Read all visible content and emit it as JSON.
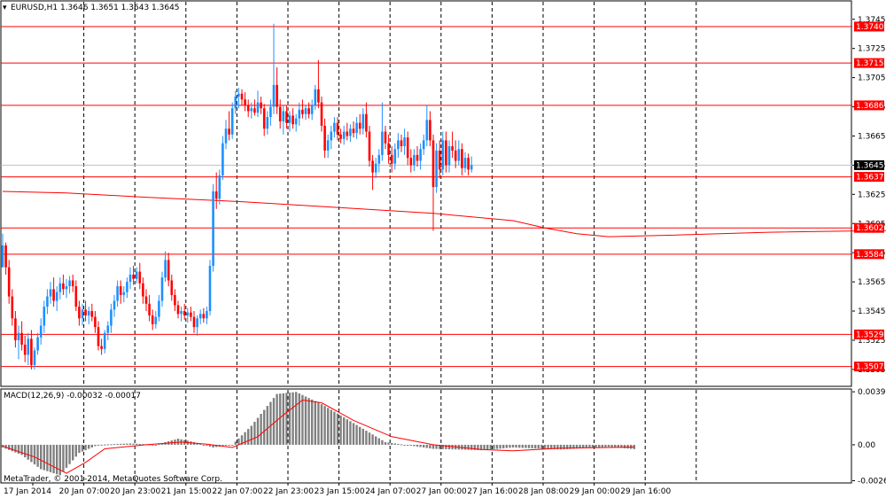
{
  "chart_data": {
    "type": "candlestick",
    "header": "EURUSD,H1  1.3646 1.3651 1.3643 1.3645",
    "colors": {
      "background": "#ffffff",
      "frame": "#000000",
      "bull_body": "#1e90ff",
      "bear_body": "#ff0000",
      "wick_up": "#1e90ff",
      "wick_down": "#ff0000",
      "level_line": "#ff0000",
      "ma_line": "#ff0000",
      "grid": "#000000",
      "macd_hist": "#808080",
      "macd_signal": "#ff0000",
      "price_line": "#c0c0c0",
      "current_box": "#000000"
    },
    "price_axis": {
      "ylim": [
        1.3494,
        1.3757
      ],
      "ticks": [
        "1.3745",
        "1.3725",
        "1.3705",
        "1.3685",
        "1.3665",
        "1.3645",
        "1.3625",
        "1.3605",
        "1.3585",
        "1.3565",
        "1.3545",
        "1.3525",
        "1.3505"
      ]
    },
    "levels": [
      "1.3740",
      "1.3715",
      "1.3686",
      "1.3637",
      "1.3602",
      "1.3584",
      "1.3529",
      "1.3507"
    ],
    "current_price": "1.3645",
    "ma_points": [
      [
        0,
        1.3627
      ],
      [
        20,
        1.3626
      ],
      [
        45,
        1.3623
      ],
      [
        75,
        1.362
      ],
      [
        105,
        1.3616
      ],
      [
        135,
        1.3612
      ],
      [
        160,
        1.3607
      ],
      [
        170,
        1.3602
      ],
      [
        180,
        1.3598
      ],
      [
        190,
        1.3596
      ],
      [
        210,
        1.3597
      ],
      [
        240,
        1.3599
      ],
      [
        270,
        1.36
      ],
      [
        300,
        1.3601
      ],
      [
        330,
        1.3607
      ],
      [
        360,
        1.3611
      ],
      [
        390,
        1.3614
      ],
      [
        415,
        1.362
      ]
    ],
    "x_ticks": [
      "17 Jan 2014",
      "20 Jan 07:00",
      "20 Jan 23:00",
      "21 Jan 15:00",
      "22 Jan 07:00",
      "22 Jan 23:00",
      "23 Jan 15:00",
      "24 Jan 07:00",
      "27 Jan 00:00",
      "27 Jan 16:00",
      "28 Jan 08:00",
      "29 Jan 00:00",
      "29 Jan 16:00"
    ],
    "candles_per_tick": 16,
    "ohlc": [
      [
        1.3575,
        1.3598,
        1.3575,
        1.359
      ],
      [
        1.359,
        1.3592,
        1.357,
        1.3575
      ],
      [
        1.3575,
        1.358,
        1.355,
        1.3555
      ],
      [
        1.3555,
        1.356,
        1.3535,
        1.354
      ],
      [
        1.354,
        1.3545,
        1.352,
        1.3525
      ],
      [
        1.3525,
        1.3535,
        1.3512,
        1.353
      ],
      [
        1.353,
        1.3538,
        1.3518,
        1.3522
      ],
      [
        1.3522,
        1.3528,
        1.351,
        1.3515
      ],
      [
        1.3515,
        1.353,
        1.3508,
        1.3526
      ],
      [
        1.3526,
        1.3532,
        1.3505,
        1.3508
      ],
      [
        1.3508,
        1.352,
        1.3505,
        1.3518
      ],
      [
        1.3518,
        1.353,
        1.3515,
        1.3527
      ],
      [
        1.3527,
        1.354,
        1.3522,
        1.3535
      ],
      [
        1.3535,
        1.3552,
        1.353,
        1.3548
      ],
      [
        1.3548,
        1.356,
        1.3543,
        1.3555
      ],
      [
        1.3555,
        1.3565,
        1.355,
        1.356
      ],
      [
        1.356,
        1.3568,
        1.3548,
        1.3552
      ],
      [
        1.3552,
        1.3562,
        1.3545,
        1.3558
      ],
      [
        1.3558,
        1.3568,
        1.3553,
        1.3564
      ],
      [
        1.3564,
        1.357,
        1.3556,
        1.356
      ],
      [
        1.356,
        1.3567,
        1.3554,
        1.3562
      ],
      [
        1.3562,
        1.3569,
        1.3557,
        1.3566
      ],
      [
        1.3566,
        1.357,
        1.3558,
        1.3562
      ],
      [
        1.3562,
        1.3566,
        1.3545,
        1.3548
      ],
      [
        1.3548,
        1.3552,
        1.3535,
        1.354
      ],
      [
        1.354,
        1.355,
        1.3535,
        1.3546
      ],
      [
        1.3546,
        1.3552,
        1.3538,
        1.3542
      ],
      [
        1.3542,
        1.3548,
        1.3536,
        1.3545
      ],
      [
        1.3545,
        1.355,
        1.3538,
        1.3541
      ],
      [
        1.3541,
        1.3545,
        1.353,
        1.3534
      ],
      [
        1.3534,
        1.3538,
        1.3518,
        1.3521
      ],
      [
        1.3521,
        1.3526,
        1.3515,
        1.3519
      ],
      [
        1.3519,
        1.3532,
        1.3516,
        1.353
      ],
      [
        1.353,
        1.3538,
        1.3525,
        1.3535
      ],
      [
        1.3535,
        1.355,
        1.353,
        1.3546
      ],
      [
        1.3546,
        1.3556,
        1.3541,
        1.3552
      ],
      [
        1.3552,
        1.3566,
        1.3548,
        1.3562
      ],
      [
        1.3562,
        1.3566,
        1.355,
        1.3556
      ],
      [
        1.3556,
        1.3562,
        1.3551,
        1.3558
      ],
      [
        1.3558,
        1.3568,
        1.3554,
        1.3565
      ],
      [
        1.3565,
        1.3575,
        1.356,
        1.357
      ],
      [
        1.357,
        1.3576,
        1.3563,
        1.3567
      ],
      [
        1.3567,
        1.3575,
        1.3564,
        1.3572
      ],
      [
        1.3572,
        1.3578,
        1.356,
        1.3564
      ],
      [
        1.3564,
        1.3568,
        1.355,
        1.3555
      ],
      [
        1.3555,
        1.356,
        1.3545,
        1.355
      ],
      [
        1.355,
        1.3556,
        1.3538,
        1.3542
      ],
      [
        1.3542,
        1.3546,
        1.3532,
        1.3536
      ],
      [
        1.3536,
        1.3545,
        1.3533,
        1.3541
      ],
      [
        1.3541,
        1.3556,
        1.3538,
        1.3552
      ],
      [
        1.3552,
        1.3572,
        1.3548,
        1.3568
      ],
      [
        1.3568,
        1.3586,
        1.3565,
        1.358
      ],
      [
        1.358,
        1.3585,
        1.3562,
        1.3566
      ],
      [
        1.3566,
        1.357,
        1.3552,
        1.3556
      ],
      [
        1.3556,
        1.356,
        1.3545,
        1.3549
      ],
      [
        1.3549,
        1.3552,
        1.354,
        1.3543
      ],
      [
        1.3543,
        1.3548,
        1.3538,
        1.3545
      ],
      [
        1.3545,
        1.355,
        1.3539,
        1.3542
      ],
      [
        1.3542,
        1.3547,
        1.3537,
        1.3544
      ],
      [
        1.3544,
        1.3548,
        1.3538,
        1.3541
      ],
      [
        1.3541,
        1.3545,
        1.353,
        1.3534
      ],
      [
        1.3534,
        1.3542,
        1.3528,
        1.354
      ],
      [
        1.354,
        1.3546,
        1.3536,
        1.3543
      ],
      [
        1.3543,
        1.3547,
        1.3537,
        1.354
      ],
      [
        1.354,
        1.3548,
        1.3536,
        1.3545
      ],
      [
        1.3545,
        1.358,
        1.3542,
        1.3576
      ],
      [
        1.3576,
        1.3632,
        1.3572,
        1.3627
      ],
      [
        1.3627,
        1.364,
        1.3615,
        1.3622
      ],
      [
        1.3622,
        1.3642,
        1.3618,
        1.3638
      ],
      [
        1.3638,
        1.3665,
        1.3635,
        1.366
      ],
      [
        1.366,
        1.3676,
        1.3656,
        1.367
      ],
      [
        1.367,
        1.3682,
        1.3662,
        1.3666
      ],
      [
        1.3666,
        1.3688,
        1.3663,
        1.3684
      ],
      [
        1.3684,
        1.3696,
        1.368,
        1.3692
      ],
      [
        1.3692,
        1.3698,
        1.3684,
        1.3694
      ],
      [
        1.3694,
        1.3697,
        1.3686,
        1.369
      ],
      [
        1.369,
        1.3695,
        1.3682,
        1.3686
      ],
      [
        1.3686,
        1.369,
        1.3678,
        1.3682
      ],
      [
        1.3682,
        1.3688,
        1.3677,
        1.3684
      ],
      [
        1.3684,
        1.369,
        1.3679,
        1.3681
      ],
      [
        1.3681,
        1.3696,
        1.3678,
        1.3688
      ],
      [
        1.3688,
        1.3692,
        1.368,
        1.3684
      ],
      [
        1.3684,
        1.3687,
        1.3665,
        1.367
      ],
      [
        1.367,
        1.3682,
        1.3666,
        1.3678
      ],
      [
        1.3678,
        1.369,
        1.3672,
        1.3685
      ],
      [
        1.3685,
        1.3742,
        1.368,
        1.37
      ],
      [
        1.37,
        1.3712,
        1.368,
        1.3685
      ],
      [
        1.3685,
        1.369,
        1.367,
        1.3675
      ],
      [
        1.3675,
        1.3686,
        1.3666,
        1.3682
      ],
      [
        1.3682,
        1.3686,
        1.367,
        1.3674
      ],
      [
        1.3674,
        1.3682,
        1.3668,
        1.3679
      ],
      [
        1.3679,
        1.3684,
        1.367,
        1.3673
      ],
      [
        1.3673,
        1.368,
        1.3668,
        1.3677
      ],
      [
        1.3677,
        1.3688,
        1.3672,
        1.3683
      ],
      [
        1.3683,
        1.369,
        1.3677,
        1.368
      ],
      [
        1.368,
        1.3686,
        1.3676,
        1.3684
      ],
      [
        1.3684,
        1.3688,
        1.3677,
        1.368
      ],
      [
        1.368,
        1.369,
        1.3676,
        1.3686
      ],
      [
        1.3686,
        1.37,
        1.3683,
        1.3697
      ],
      [
        1.3697,
        1.3717,
        1.3684,
        1.3688
      ],
      [
        1.3688,
        1.3692,
        1.3668,
        1.3672
      ],
      [
        1.3672,
        1.3677,
        1.365,
        1.3655
      ],
      [
        1.3655,
        1.3666,
        1.365,
        1.3662
      ],
      [
        1.3662,
        1.3672,
        1.3656,
        1.3668
      ],
      [
        1.3668,
        1.3678,
        1.3664,
        1.3674
      ],
      [
        1.3674,
        1.3678,
        1.3662,
        1.3666
      ],
      [
        1.3666,
        1.367,
        1.366,
        1.3663
      ],
      [
        1.3663,
        1.3672,
        1.3659,
        1.3668
      ],
      [
        1.3668,
        1.3674,
        1.3662,
        1.3665
      ],
      [
        1.3665,
        1.3673,
        1.3661,
        1.367
      ],
      [
        1.367,
        1.3675,
        1.3664,
        1.3667
      ],
      [
        1.3667,
        1.3678,
        1.3663,
        1.3674
      ],
      [
        1.3674,
        1.368,
        1.3666,
        1.367
      ],
      [
        1.367,
        1.3684,
        1.3666,
        1.368
      ],
      [
        1.368,
        1.3688,
        1.3664,
        1.3668
      ],
      [
        1.3668,
        1.3672,
        1.3644,
        1.3648
      ],
      [
        1.3648,
        1.3652,
        1.3628,
        1.364
      ],
      [
        1.364,
        1.365,
        1.3636,
        1.3646
      ],
      [
        1.3646,
        1.3656,
        1.364,
        1.3652
      ],
      [
        1.3652,
        1.3688,
        1.3648,
        1.3668
      ],
      [
        1.3668,
        1.3672,
        1.3656,
        1.366
      ],
      [
        1.366,
        1.3666,
        1.3646,
        1.3652
      ],
      [
        1.3652,
        1.3658,
        1.364,
        1.3646
      ],
      [
        1.3646,
        1.366,
        1.3642,
        1.3656
      ],
      [
        1.3656,
        1.3667,
        1.365,
        1.3662
      ],
      [
        1.3662,
        1.3666,
        1.3654,
        1.3658
      ],
      [
        1.3658,
        1.367,
        1.3652,
        1.3664
      ],
      [
        1.3664,
        1.3668,
        1.3645,
        1.365
      ],
      [
        1.365,
        1.3656,
        1.364,
        1.3645
      ],
      [
        1.3645,
        1.3656,
        1.3641,
        1.3652
      ],
      [
        1.3652,
        1.3658,
        1.3644,
        1.3648
      ],
      [
        1.3648,
        1.366,
        1.3642,
        1.3656
      ],
      [
        1.3656,
        1.3666,
        1.3652,
        1.3662
      ],
      [
        1.3662,
        1.3686,
        1.3658,
        1.3676
      ],
      [
        1.3676,
        1.3682,
        1.3658,
        1.3662
      ],
      [
        1.3662,
        1.3666,
        1.36,
        1.363
      ],
      [
        1.363,
        1.366,
        1.3626,
        1.3655
      ],
      [
        1.3655,
        1.3662,
        1.3636,
        1.3642
      ],
      [
        1.3642,
        1.3668,
        1.3638,
        1.3662
      ],
      [
        1.3662,
        1.3668,
        1.364,
        1.3645
      ],
      [
        1.3645,
        1.3662,
        1.364,
        1.3658
      ],
      [
        1.3658,
        1.3668,
        1.365,
        1.3655
      ],
      [
        1.3655,
        1.3662,
        1.3643,
        1.3648
      ],
      [
        1.3648,
        1.3662,
        1.3645,
        1.3656
      ],
      [
        1.3656,
        1.366,
        1.3638,
        1.3643
      ],
      [
        1.3643,
        1.3654,
        1.364,
        1.365
      ],
      [
        1.365,
        1.3653,
        1.3638,
        1.3642
      ],
      [
        1.3642,
        1.3651,
        1.364,
        1.3645
      ]
    ],
    "macd": {
      "label": "MACD(12,26,9) -0.00032 -0.00017",
      "ylim": [
        -0.00275,
        0.00405
      ],
      "ticks": [
        "0.00391",
        "0.00",
        "-0.00265"
      ],
      "hist_points": [
        [
          0,
          -0.0002
        ],
        [
          6,
          -0.00075
        ],
        [
          12,
          -0.0018
        ],
        [
          18,
          -0.00225
        ],
        [
          24,
          -0.0006
        ],
        [
          30,
          0.0
        ],
        [
          40,
          0.0001
        ],
        [
          48,
          0.0
        ],
        [
          55,
          0.00045
        ],
        [
          60,
          0.0002
        ],
        [
          66,
          -0.0002
        ],
        [
          72,
          0.0
        ],
        [
          78,
          0.0014
        ],
        [
          86,
          0.00375
        ],
        [
          92,
          0.0039
        ],
        [
          100,
          0.003
        ],
        [
          110,
          0.0016
        ],
        [
          120,
          0.0002
        ],
        [
          135,
          -0.0003
        ],
        [
          150,
          -0.0004
        ],
        [
          160,
          -0.0002
        ],
        [
          175,
          -0.00035
        ],
        [
          190,
          -0.00015
        ],
        [
          198,
          -0.00032
        ]
      ],
      "signal_points": [
        [
          0,
          -0.0001
        ],
        [
          10,
          -0.0009
        ],
        [
          20,
          -0.0021
        ],
        [
          26,
          -0.0013
        ],
        [
          32,
          -0.0003
        ],
        [
          45,
          0.0
        ],
        [
          56,
          0.0002
        ],
        [
          64,
          5e-05
        ],
        [
          72,
          -0.0002
        ],
        [
          80,
          0.0006
        ],
        [
          88,
          0.0022
        ],
        [
          94,
          0.0033
        ],
        [
          100,
          0.0031
        ],
        [
          110,
          0.0018
        ],
        [
          122,
          0.0006
        ],
        [
          135,
          0.0
        ],
        [
          150,
          -0.00035
        ],
        [
          160,
          -0.00045
        ],
        [
          175,
          -0.00025
        ],
        [
          190,
          -0.0002
        ],
        [
          198,
          -0.00017
        ]
      ]
    },
    "footer": "MetaTrader, © 2001-2014, MetaQuotes Software Corp."
  }
}
